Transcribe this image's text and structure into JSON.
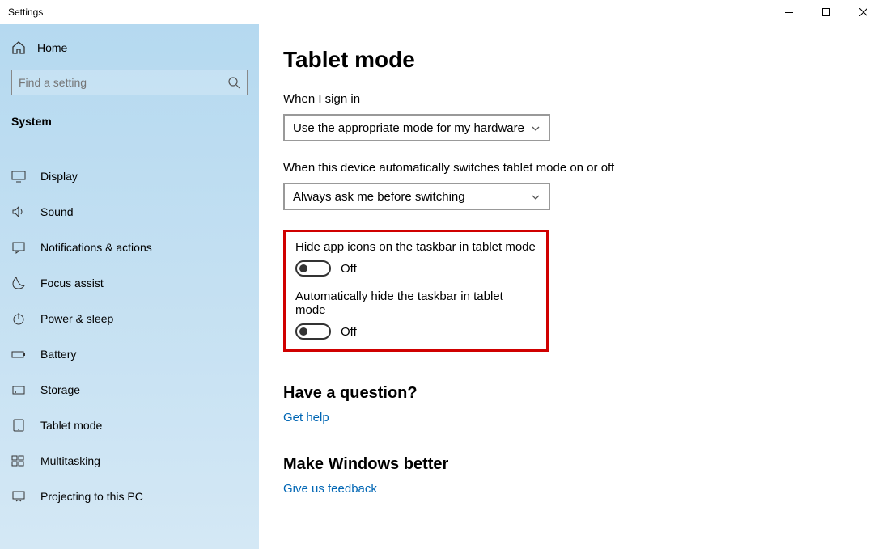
{
  "window": {
    "title": "Settings"
  },
  "sidebar": {
    "home_label": "Home",
    "search_placeholder": "Find a setting",
    "category": "System",
    "items": [
      {
        "label": "Display",
        "icon": "display-icon"
      },
      {
        "label": "Sound",
        "icon": "sound-icon"
      },
      {
        "label": "Notifications & actions",
        "icon": "notifications-icon"
      },
      {
        "label": "Focus assist",
        "icon": "focus-assist-icon"
      },
      {
        "label": "Power & sleep",
        "icon": "power-icon"
      },
      {
        "label": "Battery",
        "icon": "battery-icon"
      },
      {
        "label": "Storage",
        "icon": "storage-icon"
      },
      {
        "label": "Tablet mode",
        "icon": "tablet-icon"
      },
      {
        "label": "Multitasking",
        "icon": "multitasking-icon"
      },
      {
        "label": "Projecting to this PC",
        "icon": "projecting-icon"
      }
    ]
  },
  "main": {
    "title": "Tablet mode",
    "signin_label": "When I sign in",
    "signin_value": "Use the appropriate mode for my hardware",
    "switch_label": "When this device automatically switches tablet mode on or off",
    "switch_value": "Always ask me before switching",
    "toggle1_label": "Hide app icons on the taskbar in tablet mode",
    "toggle1_state": "Off",
    "toggle2_label": "Automatically hide the taskbar in tablet mode",
    "toggle2_state": "Off",
    "question_heading": "Have a question?",
    "question_link": "Get help",
    "feedback_heading": "Make Windows better",
    "feedback_link": "Give us feedback"
  }
}
